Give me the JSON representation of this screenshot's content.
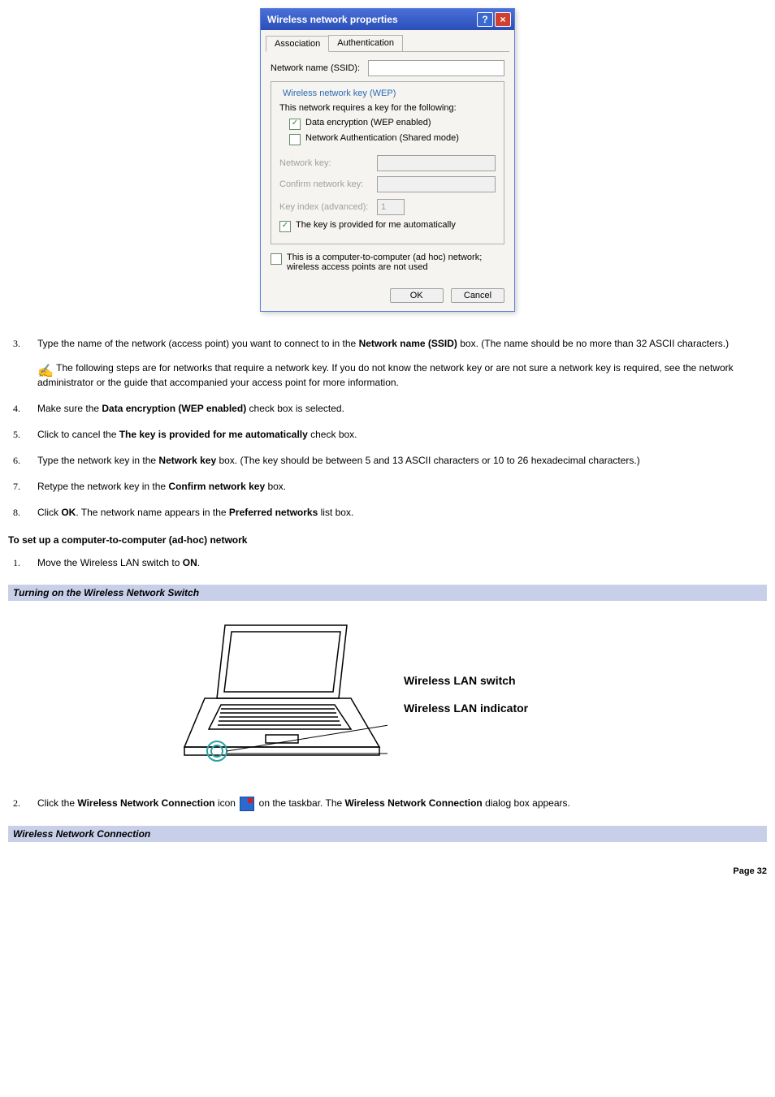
{
  "dialog": {
    "title": "Wireless network properties",
    "tabs": {
      "association": "Association",
      "authentication": "Authentication"
    },
    "ssid_label": "Network name (SSID):",
    "wep_group": "Wireless network key (WEP)",
    "wep_intro": "This network requires a key for the following:",
    "chk_data_encryption": "Data encryption (WEP enabled)",
    "chk_net_auth": "Network Authentication (Shared mode)",
    "netkey_label": "Network key:",
    "confirm_label": "Confirm network key:",
    "keyindex_label": "Key index (advanced):",
    "keyindex_value": "1",
    "chk_key_auto": "The key is provided for me automatically",
    "chk_adhoc": "This is a computer-to-computer (ad hoc) network; wireless access points are not used",
    "ok": "OK",
    "cancel": "Cancel"
  },
  "steps_a": {
    "s3": {
      "num": "3.",
      "pre": "Type the name of the network (access point) you want to connect to in the ",
      "b1": "Network name (SSID)",
      "post": " box. (The name should be no more than 32 ASCII characters.)",
      "note": " The following steps are for networks that require a network key. If you do not know the network key or are not sure a network key is required, see the network administrator or the guide that accompanied your access point for more information."
    },
    "s4": {
      "num": "4.",
      "pre": "Make sure the ",
      "b1": "Data encryption (WEP enabled)",
      "post": " check box is selected."
    },
    "s5": {
      "num": "5.",
      "pre": "Click to cancel the ",
      "b1": "The key is provided for me automatically",
      "post": " check box."
    },
    "s6": {
      "num": "6.",
      "pre": "Type the network key in the ",
      "b1": "Network key",
      "post": " box. (The key should be between 5 and 13 ASCII characters or 10 to 26 hexadecimal characters.)"
    },
    "s7": {
      "num": "7.",
      "pre": "Retype the network key in the ",
      "b1": "Confirm network key",
      "post": " box."
    },
    "s8": {
      "num": "8.",
      "pre": "Click ",
      "b1": "OK",
      "mid": ". The network name appears in the ",
      "b2": "Preferred networks",
      "post": " list box."
    }
  },
  "adhoc_heading": "To set up a computer-to-computer (ad-hoc) network",
  "steps_b": {
    "s1": {
      "num": "1.",
      "pre": "Move the Wireless LAN switch to ",
      "b1": "ON",
      "post": "."
    },
    "s2": {
      "num": "2.",
      "pre": "Click the ",
      "b1": "Wireless Network Connection",
      "mid1": " icon ",
      "mid2": " on the taskbar. The ",
      "b2": "Wireless Network Connection",
      "post": " dialog box appears."
    }
  },
  "captions": {
    "fig1": "Turning on the Wireless Network Switch",
    "fig2": "Wireless Network Connection"
  },
  "fig_labels": {
    "switch": "Wireless LAN switch",
    "indicator": "Wireless LAN indicator"
  },
  "page_number": "Page 32"
}
